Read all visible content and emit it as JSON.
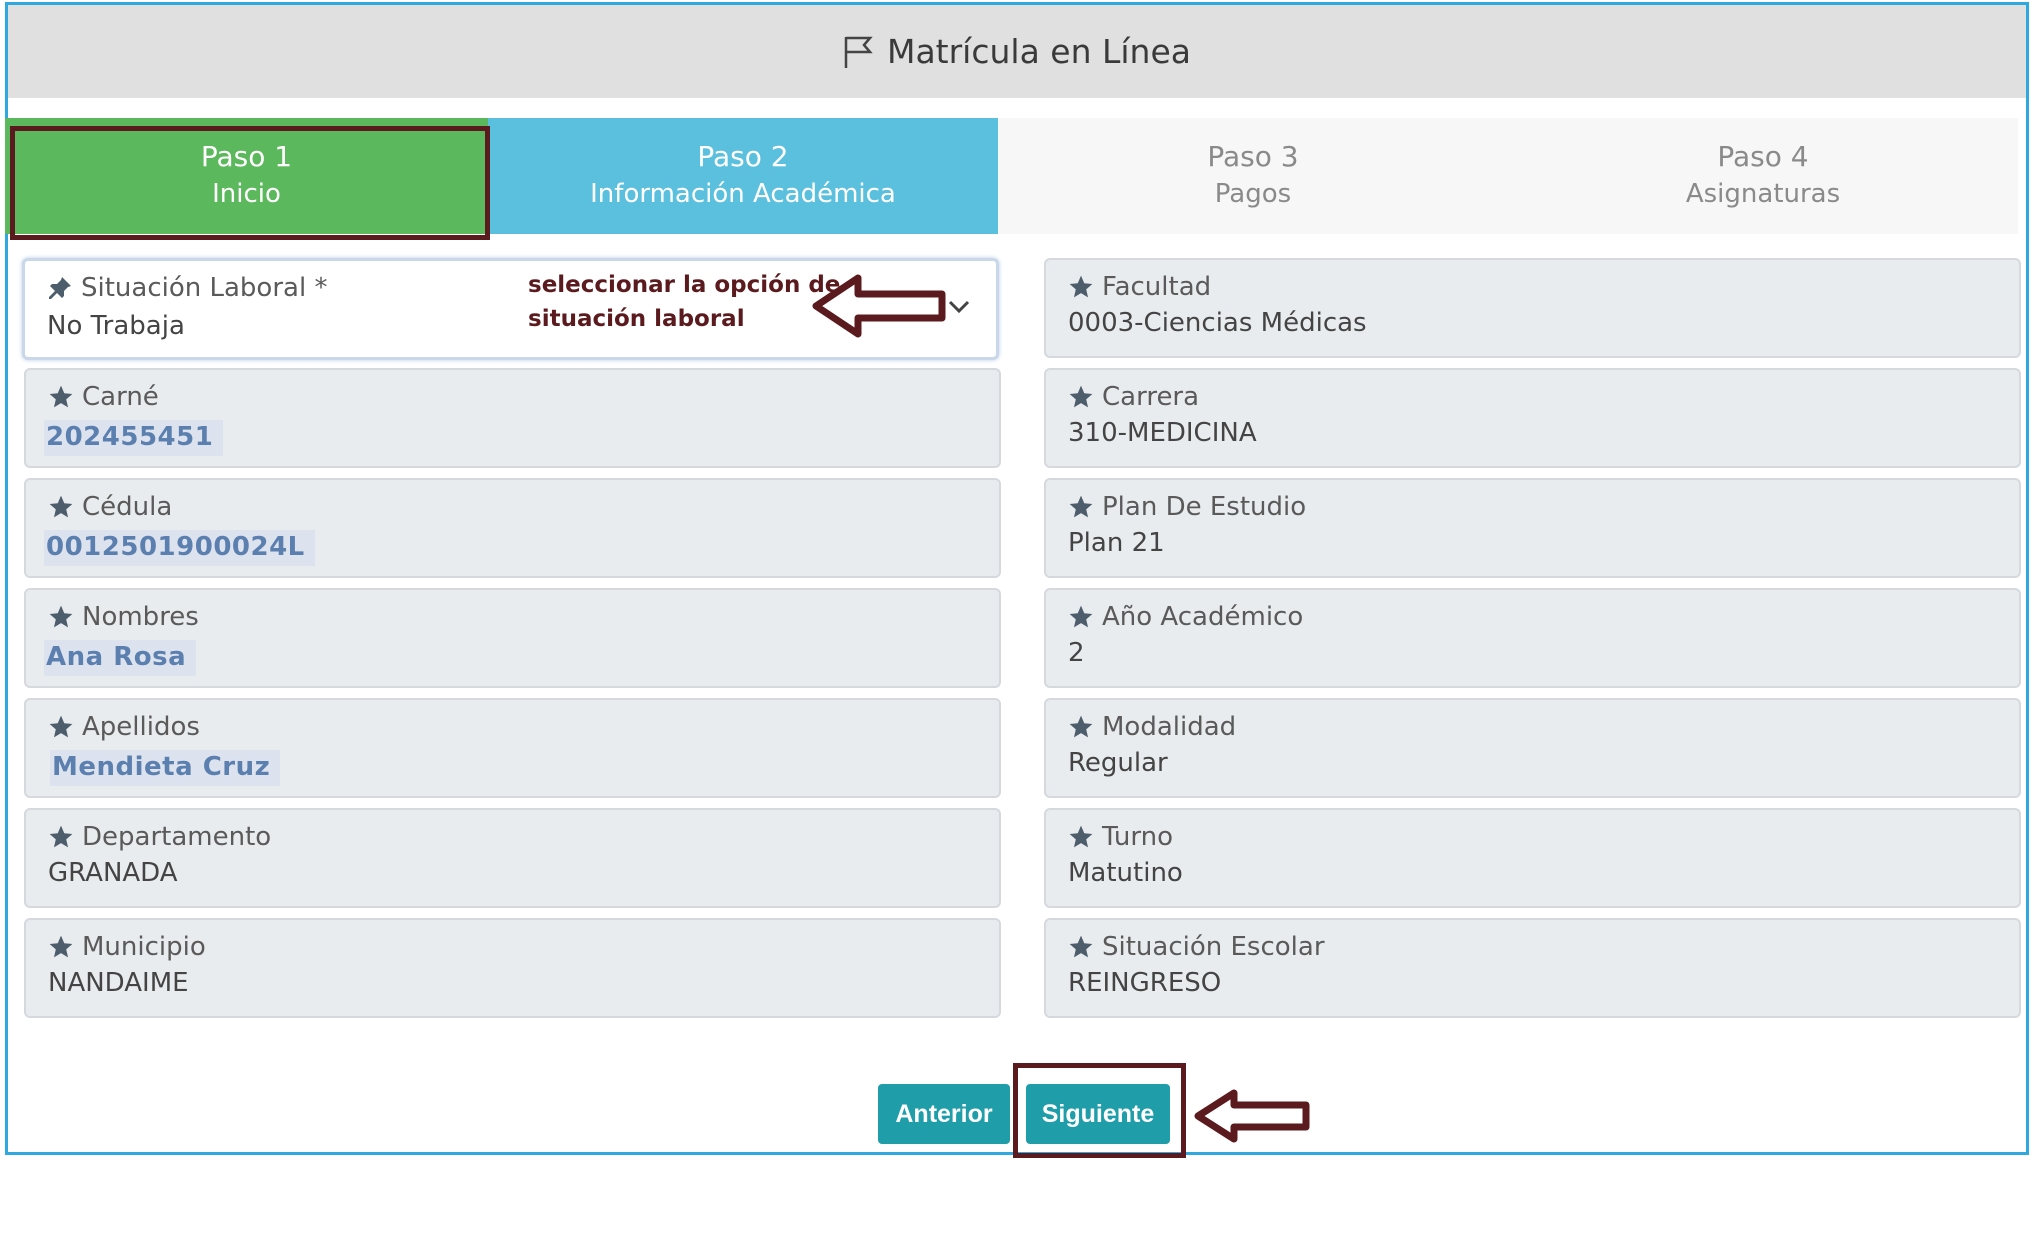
{
  "header": {
    "title": "Matrícula en Línea"
  },
  "steps": [
    {
      "num": "Paso 1",
      "label": "Inicio"
    },
    {
      "num": "Paso 2",
      "label": "Información Académica"
    },
    {
      "num": "Paso 3",
      "label": "Pagos"
    },
    {
      "num": "Paso 4",
      "label": "Asignaturas"
    }
  ],
  "left_fields": {
    "situacion": {
      "label": "Situación Laboral *",
      "value": "No Trabaja"
    },
    "carne": {
      "label": "Carné",
      "value": "202455451"
    },
    "cedula": {
      "label": "Cédula",
      "value": "0012501900024L"
    },
    "nombres": {
      "label": "Nombres",
      "value": "Ana Rosa"
    },
    "apellidos": {
      "label": "Apellidos",
      "value": "Mendieta Cruz"
    },
    "departamento": {
      "label": "Departamento",
      "value": "GRANADA"
    },
    "municipio": {
      "label": "Municipio",
      "value": "NANDAIME"
    }
  },
  "right_fields": {
    "facultad": {
      "label": "Facultad",
      "value": "0003-Ciencias Médicas"
    },
    "carrera": {
      "label": "Carrera",
      "value": "310-MEDICINA"
    },
    "plan": {
      "label": "Plan De Estudio",
      "value": "Plan 21"
    },
    "anio": {
      "label": "Año Académico",
      "value": "2"
    },
    "modalidad": {
      "label": "Modalidad",
      "value": "Regular"
    },
    "turno": {
      "label": "Turno",
      "value": "Matutino"
    },
    "situacion_escolar": {
      "label": "Situación Escolar",
      "value": "REINGRESO"
    }
  },
  "annotation": {
    "line1": "seleccionar la opción de",
    "line2": "situación laboral"
  },
  "buttons": {
    "prev": "Anterior",
    "next": "Siguiente"
  },
  "colors": {
    "step_active": "#5cb85c",
    "step_current": "#5bc0de",
    "button": "#1f9eaa",
    "highlight": "#5a1a1e",
    "frame": "#2fa8e0"
  }
}
